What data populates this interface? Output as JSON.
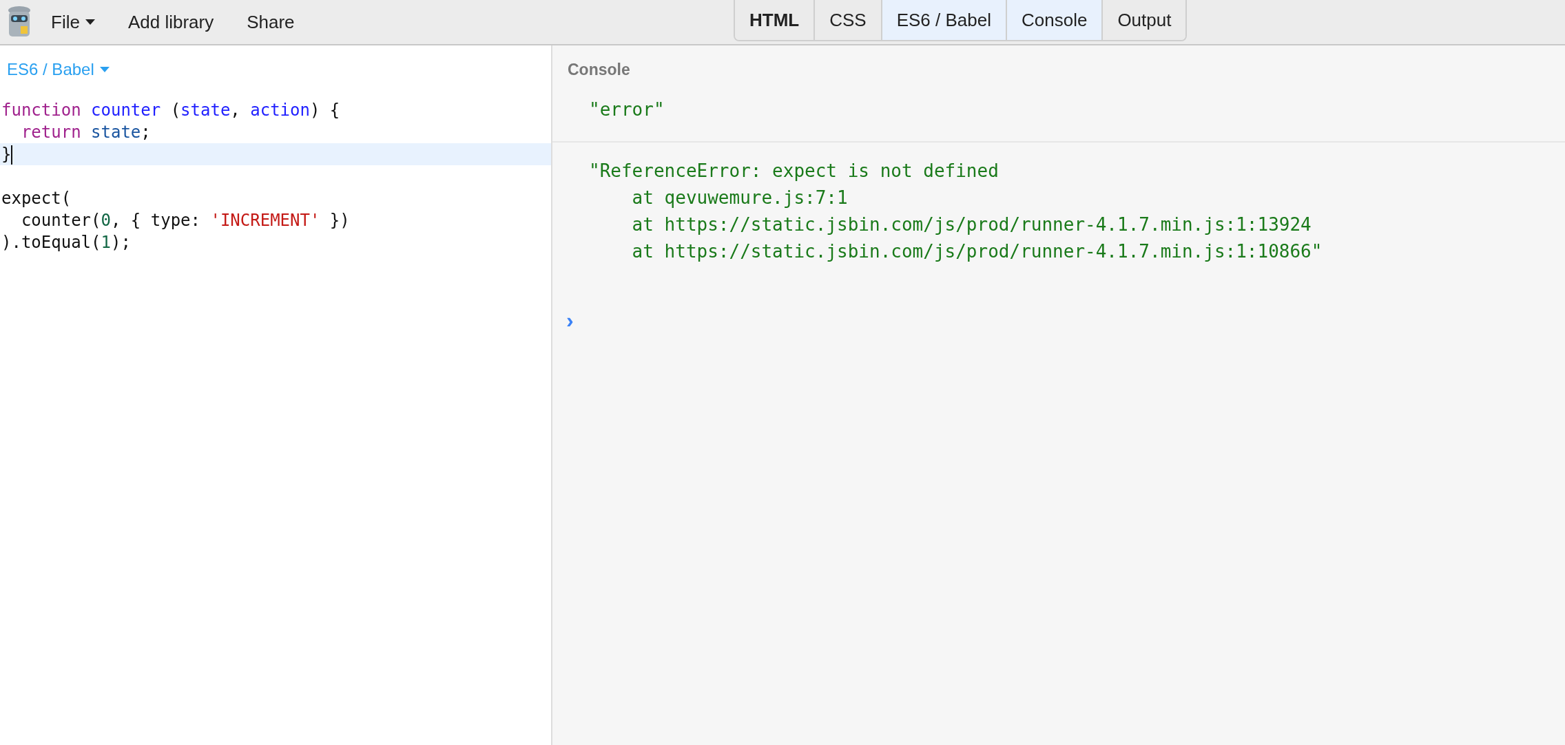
{
  "toolbar": {
    "menus": [
      {
        "label": "File",
        "dropdown": true
      },
      {
        "label": "Add library",
        "dropdown": false
      },
      {
        "label": "Share",
        "dropdown": false
      }
    ],
    "tabs": [
      {
        "label": "HTML",
        "selected": false,
        "bold": true
      },
      {
        "label": "CSS",
        "selected": false,
        "bold": false
      },
      {
        "label": "ES6 / Babel",
        "selected": true,
        "bold": false
      },
      {
        "label": "Console",
        "selected": true,
        "bold": false
      },
      {
        "label": "Output",
        "selected": false,
        "bold": false
      }
    ]
  },
  "editor": {
    "language": "ES6 / Babel",
    "lines": [
      {
        "active": false,
        "tokens": [
          {
            "kind": "keyword",
            "text": "function"
          },
          {
            "kind": "def",
            "text": " counter"
          },
          {
            "kind": "plain",
            "text": " ("
          },
          {
            "kind": "def",
            "text": "state"
          },
          {
            "kind": "plain",
            "text": ", "
          },
          {
            "kind": "def",
            "text": "action"
          },
          {
            "kind": "plain",
            "text": ") {"
          }
        ]
      },
      {
        "active": false,
        "tokens": [
          {
            "kind": "keyword",
            "text": "  return"
          },
          {
            "kind": "variable",
            "text": " state"
          },
          {
            "kind": "plain",
            "text": ";"
          }
        ]
      },
      {
        "active": true,
        "tokens": [
          {
            "kind": "plain",
            "text": "}"
          }
        ]
      },
      {
        "active": false
      },
      {
        "active": false,
        "tokens": [
          {
            "kind": "plain",
            "text": "expect("
          }
        ]
      },
      {
        "active": false,
        "tokens": [
          {
            "kind": "plain",
            "text": "  counter("
          },
          {
            "kind": "number",
            "text": "0"
          },
          {
            "kind": "plain",
            "text": ", { type: "
          },
          {
            "kind": "string",
            "text": "'INCREMENT'"
          },
          {
            "kind": "plain",
            "text": " })"
          }
        ]
      },
      {
        "active": false,
        "tokens": [
          {
            "kind": "plain",
            "text": ").toEqual("
          },
          {
            "kind": "number",
            "text": "1"
          },
          {
            "kind": "plain",
            "text": ");"
          }
        ]
      }
    ]
  },
  "console": {
    "title": "Console",
    "entries": [
      {
        "lines": [
          "\"error\""
        ]
      },
      {
        "lines": [
          "\"ReferenceError: expect is not defined",
          "    at qevuwemure.js:7:1",
          "    at https://static.jsbin.com/js/prod/runner-4.1.7.min.js:1:13924",
          "    at https://static.jsbin.com/js/prod/runner-4.1.7.min.js:1:10866\""
        ]
      }
    ],
    "prompt": "›"
  }
}
